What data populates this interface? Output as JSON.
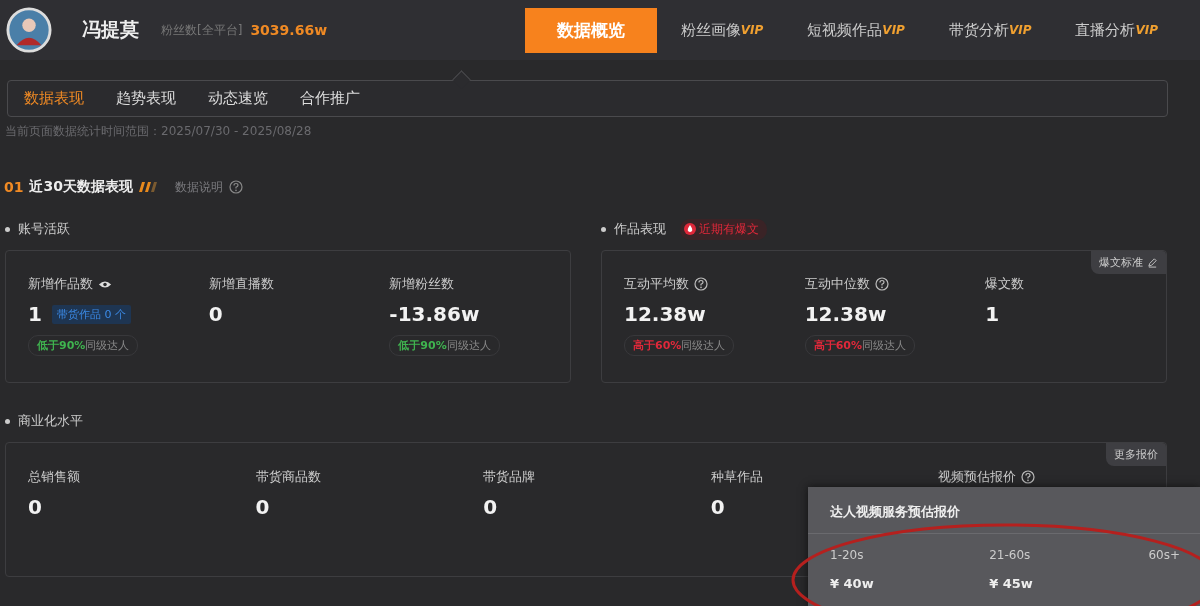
{
  "header": {
    "name": "冯提莫",
    "fans_label": "粉丝数[全平台]",
    "fans_value": "3039.66w",
    "nav": [
      {
        "label": "数据概览",
        "selected": true
      },
      {
        "label": "粉丝画像",
        "badge": "VIP",
        "selected": false
      },
      {
        "label": "短视频作品",
        "badge": "VIP",
        "selected": false
      },
      {
        "label": "带货分析",
        "badge": "VIP",
        "selected": false
      },
      {
        "label": "直播分析",
        "badge": "VIP",
        "selected": false
      }
    ]
  },
  "subtabs": [
    {
      "label": "数据表现",
      "selected": true
    },
    {
      "label": "趋势表现",
      "selected": false
    },
    {
      "label": "动态速览",
      "selected": false
    },
    {
      "label": "合作推广",
      "selected": false
    }
  ],
  "date_range": "当前页面数据统计时间范围：2025/07/30 - 2025/08/28",
  "section": {
    "number": "01",
    "title": "近30天数据表现",
    "help": "数据说明"
  },
  "account": {
    "title": "账号活跃",
    "metrics": [
      {
        "label": "新增作品数",
        "eye": true,
        "value": "1",
        "tag": "带货作品 0 个",
        "compare": {
          "kind": "low",
          "highlight": "低于90%",
          "text": "同级达人"
        }
      },
      {
        "label": "新增直播数",
        "eye": false,
        "value": "0"
      },
      {
        "label": "新增粉丝数",
        "eye": false,
        "value": "-13.86w",
        "compare": {
          "kind": "low",
          "highlight": "低于90%",
          "text": "同级达人"
        }
      }
    ]
  },
  "works": {
    "title": "作品表现",
    "hot_tag": "近期有爆文",
    "corner_button": "爆文标准",
    "metrics": [
      {
        "label": "互动平均数",
        "help": true,
        "value": "12.38w",
        "compare": {
          "kind": "high",
          "highlight": "高于60%",
          "text": "同级达人"
        }
      },
      {
        "label": "互动中位数",
        "help": true,
        "value": "12.38w",
        "compare": {
          "kind": "high",
          "highlight": "高于60%",
          "text": "同级达人"
        }
      },
      {
        "label": "爆文数",
        "help": false,
        "value": "1"
      }
    ]
  },
  "commerce": {
    "title": "商业化水平",
    "corner_button": "更多报价",
    "metrics": [
      {
        "label": "总销售额",
        "help": false,
        "value": "0"
      },
      {
        "label": "带货商品数",
        "help": false,
        "value": "0"
      },
      {
        "label": "带货品牌",
        "help": false,
        "value": "0"
      },
      {
        "label": "种草作品",
        "help": false,
        "value": "0"
      },
      {
        "label": "视频预估报价",
        "help": true
      }
    ]
  },
  "popover": {
    "title": "达人视频服务预估报价",
    "columns": [
      {
        "duration": "1-20s",
        "price": "¥ 40w"
      },
      {
        "duration": "21-60s",
        "price": "¥ 45w"
      },
      {
        "duration": "60s+"
      }
    ]
  }
}
